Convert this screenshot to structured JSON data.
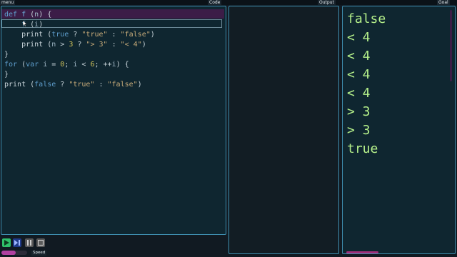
{
  "menu_label": "menu",
  "panels": {
    "code": "Code",
    "output": "Output",
    "goal": "Goal"
  },
  "code_lines": [
    [
      {
        "t": "def ",
        "c": "kw"
      },
      {
        "t": "f",
        "c": "fn"
      },
      {
        "t": " (",
        "c": ""
      },
      {
        "t": "n",
        "c": "var"
      },
      {
        "t": ") {",
        "c": ""
      }
    ],
    [
      {
        "t": "    ",
        "c": ""
      },
      {
        "t": "f",
        "c": "fn"
      },
      {
        "t": " (",
        "c": ""
      },
      {
        "t": "i",
        "c": "var"
      },
      {
        "t": ")",
        "c": ""
      }
    ],
    [
      {
        "t": "    print ",
        "c": ""
      },
      {
        "t": "(",
        "c": ""
      },
      {
        "t": "true",
        "c": "kw"
      },
      {
        "t": " ? ",
        "c": ""
      },
      {
        "t": "\"true\"",
        "c": "str"
      },
      {
        "t": " : ",
        "c": ""
      },
      {
        "t": "\"false\"",
        "c": "str"
      },
      {
        "t": ")",
        "c": ""
      }
    ],
    [
      {
        "t": "    print ",
        "c": ""
      },
      {
        "t": "(",
        "c": ""
      },
      {
        "t": "n",
        "c": "var"
      },
      {
        "t": " > ",
        "c": ""
      },
      {
        "t": "3",
        "c": "num"
      },
      {
        "t": " ? ",
        "c": ""
      },
      {
        "t": "\"> 3\"",
        "c": "str"
      },
      {
        "t": " : ",
        "c": ""
      },
      {
        "t": "\"< 4\"",
        "c": "str"
      },
      {
        "t": ")",
        "c": ""
      }
    ],
    [
      {
        "t": "}",
        "c": ""
      }
    ],
    [
      {
        "t": "for",
        "c": "kw"
      },
      {
        "t": " (",
        "c": ""
      },
      {
        "t": "var ",
        "c": "kw"
      },
      {
        "t": "i",
        "c": "var"
      },
      {
        "t": " = ",
        "c": ""
      },
      {
        "t": "0",
        "c": "num"
      },
      {
        "t": "; ",
        "c": ""
      },
      {
        "t": "i",
        "c": "var"
      },
      {
        "t": " < ",
        "c": ""
      },
      {
        "t": "6",
        "c": "num"
      },
      {
        "t": "; ++",
        "c": ""
      },
      {
        "t": "i",
        "c": "var"
      },
      {
        "t": ") {",
        "c": ""
      }
    ],
    [
      {
        "t": "}",
        "c": ""
      }
    ],
    [
      {
        "t": "print ",
        "c": ""
      },
      {
        "t": "(",
        "c": ""
      },
      {
        "t": "false",
        "c": "kw"
      },
      {
        "t": " ? ",
        "c": ""
      },
      {
        "t": "\"true\"",
        "c": "str"
      },
      {
        "t": " : ",
        "c": ""
      },
      {
        "t": "\"false\"",
        "c": "str"
      },
      {
        "t": ")",
        "c": ""
      }
    ]
  ],
  "output_lines": [],
  "goal_lines": [
    "false",
    "< 4",
    "< 4",
    "< 4",
    "< 4",
    "> 3",
    "> 3",
    "true"
  ],
  "controls": {
    "speed_label": "Speed",
    "speed_level": 0.55
  },
  "colors": {
    "goal_text": "#b5f08a",
    "highlight": "#3c1d47",
    "panel_border": "#3f8fb0",
    "play": "#2fbf6a"
  },
  "icons": {
    "play": "play-icon",
    "step": "step-icon",
    "pause": "pause-icon",
    "stop": "stop-icon",
    "cursor": "pointer-cursor-icon"
  }
}
